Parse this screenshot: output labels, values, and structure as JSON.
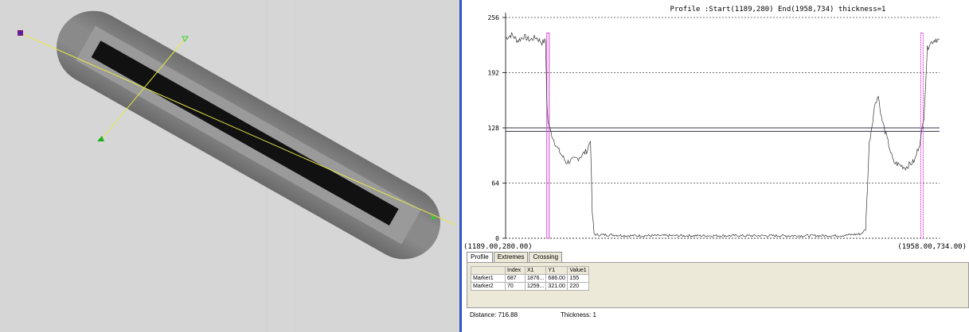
{
  "profile": {
    "title": "Profile :Start(1189,280)  End(1958,734) thickness=1",
    "start_label": "(1189.00,280.00)",
    "end_label": "(1958.00,734.00)"
  },
  "tabs": [
    {
      "label": "Profile"
    },
    {
      "label": "Extremes"
    },
    {
      "label": "Crossing"
    }
  ],
  "table": {
    "headers": [
      "",
      "Index",
      "X1",
      "Y1",
      "Value1"
    ],
    "rows": [
      [
        "Marker1",
        "687",
        "1876...",
        "686.00",
        "155"
      ],
      [
        "Marker2",
        "70",
        "1259...",
        "321.00",
        "220"
      ]
    ]
  },
  "status": {
    "distance_label": "Distance: 716.88",
    "thickness_label": "Thickness: 1"
  },
  "chart_data": {
    "type": "line",
    "title": "Profile :Start(1189,280)  End(1958,734) thickness=1",
    "ylim": [
      0,
      256
    ],
    "yticks": [
      "0",
      "64",
      "128",
      "192",
      "256"
    ],
    "xlim": [
      0,
      716
    ],
    "grid": true,
    "threshold_lines": [
      124,
      128
    ],
    "markers": [
      70,
      687
    ],
    "series": [
      {
        "x": [
          0,
          10,
          20,
          30,
          40,
          50,
          60,
          66,
          68,
          70,
          75,
          85,
          100,
          120,
          135,
          140,
          143,
          146,
          150,
          175,
          200,
          300,
          400,
          500,
          550,
          586,
          594,
          600,
          610,
          615,
          620,
          640,
          660,
          675,
          685,
          690,
          696,
          700,
          710,
          720,
          740,
          760,
          768
        ],
        "y": [
          232,
          236,
          229,
          234,
          230,
          233,
          227,
          229,
          160,
          135,
          122,
          105,
          88,
          93,
          102,
          115,
          30,
          5,
          4,
          4,
          3,
          3,
          3,
          3,
          3,
          5,
          10,
          110,
          158,
          165,
          140,
          88,
          82,
          90,
          115,
          140,
          220,
          226,
          231,
          228,
          234,
          227,
          225
        ]
      }
    ]
  }
}
